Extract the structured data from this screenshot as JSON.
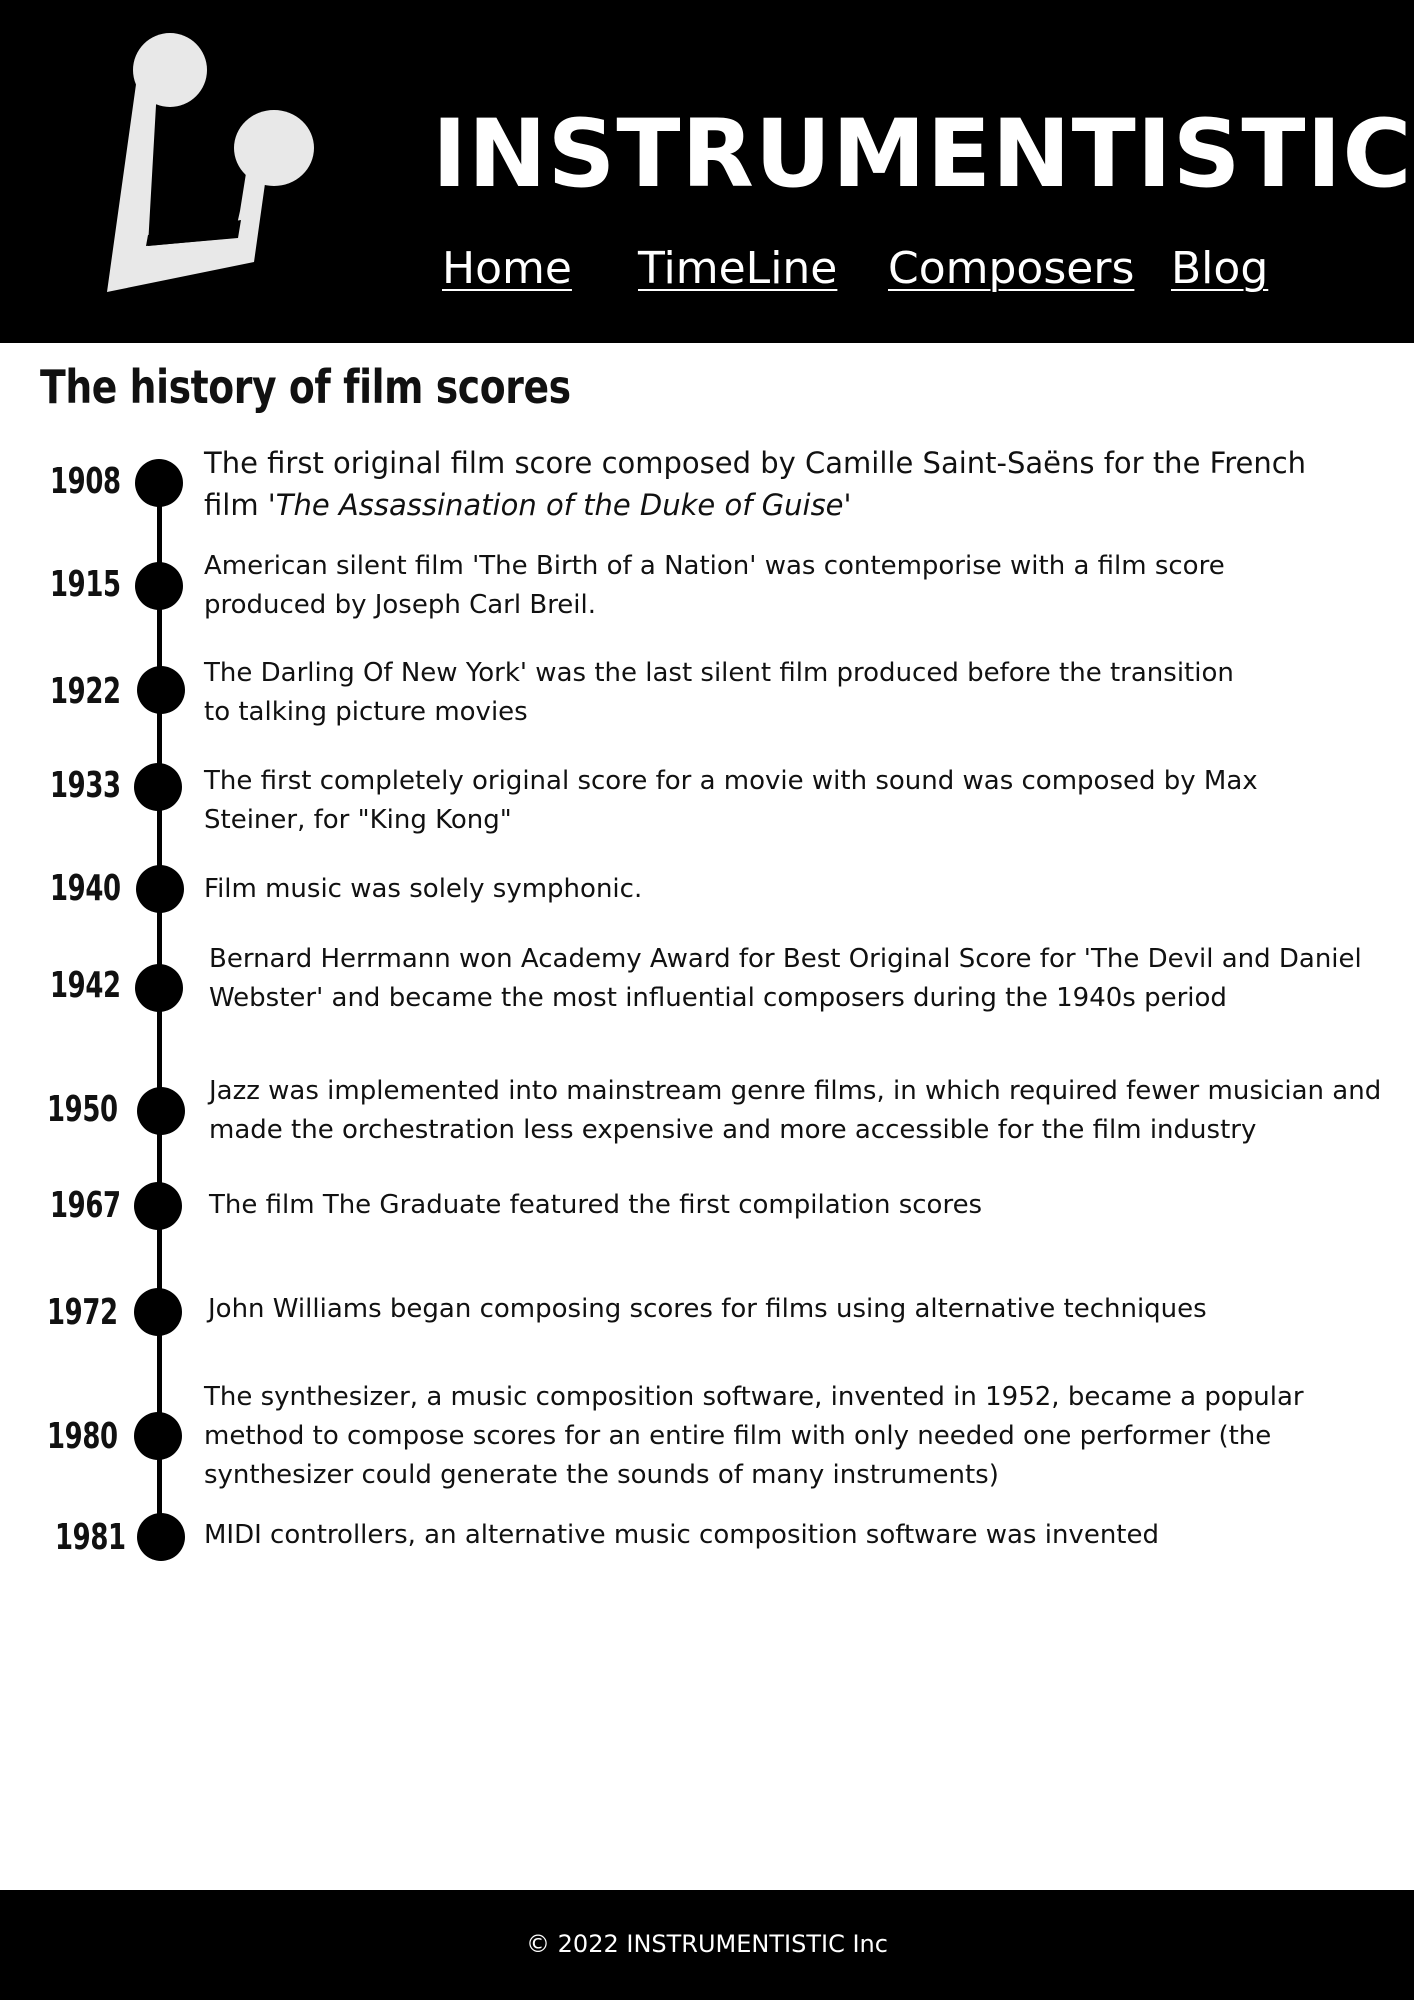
{
  "header": {
    "brand": "INSTRUMENTISTIC",
    "logo_icon": "music-note-icon",
    "nav": [
      {
        "label": "Home"
      },
      {
        "label": "TimeLine"
      },
      {
        "label": "Composers"
      },
      {
        "label": "Blog"
      }
    ]
  },
  "main": {
    "title": "The history of film scores",
    "timeline": [
      {
        "year": "1908",
        "lines": [
          "The first original film score composed by Camille Saint-Saëns for the French",
          "film '"
        ],
        "italic": "The Assassination of the Duke of Guise",
        "after_italic": "'"
      },
      {
        "year": "1915",
        "lines": [
          "American silent film 'The Birth of a Nation'  was  contemporise with a film score",
          "produced by Joseph Carl Breil."
        ]
      },
      {
        "year": "1922",
        "lines": [
          "The Darling Of New York' was the last silent film produced before the transition",
          "to talking picture movies"
        ]
      },
      {
        "year": "1933",
        "lines": [
          "The first completely original score for a movie with sound was composed by Max",
          "Steiner, for \"King Kong\""
        ]
      },
      {
        "year": "1940",
        "lines": [
          "Film music was solely symphonic."
        ]
      },
      {
        "year": "1942",
        "lines": [
          "Bernard Herrmann won Academy Award for Best Original Score for 'The Devil and Daniel",
          "Webster' and became the most influential composers during the 1940s period"
        ]
      },
      {
        "year": "1950",
        "lines": [
          "Jazz was implemented into mainstream genre films, in which required fewer musician and",
          "made the orchestration less expensive and more accessible for the film industry"
        ]
      },
      {
        "year": "1967",
        "lines": [
          "The film The Graduate featured the first compilation scores"
        ]
      },
      {
        "year": "1972",
        "lines": [
          "John Williams began composing scores for films using alternative techniques"
        ]
      },
      {
        "year": "1980",
        "lines": [
          "The synthesizer, a music composition software, invented in 1952, became a popular",
          "method to compose scores for an entire film with only needed one performer  (the",
          "synthesizer could generate the sounds of many instruments)"
        ]
      },
      {
        "year": "1981",
        "lines": [
          "MIDI controllers, an alternative music composition software was invented"
        ]
      }
    ]
  },
  "footer": {
    "copyright": "© 2022 INSTRUMENTISTIC Inc"
  },
  "colors": {
    "header_bg": "#000000",
    "header_text": "#ffffff",
    "logo": "#e8e8e8",
    "body_bg": "#ffffff",
    "timeline": "#000000"
  }
}
